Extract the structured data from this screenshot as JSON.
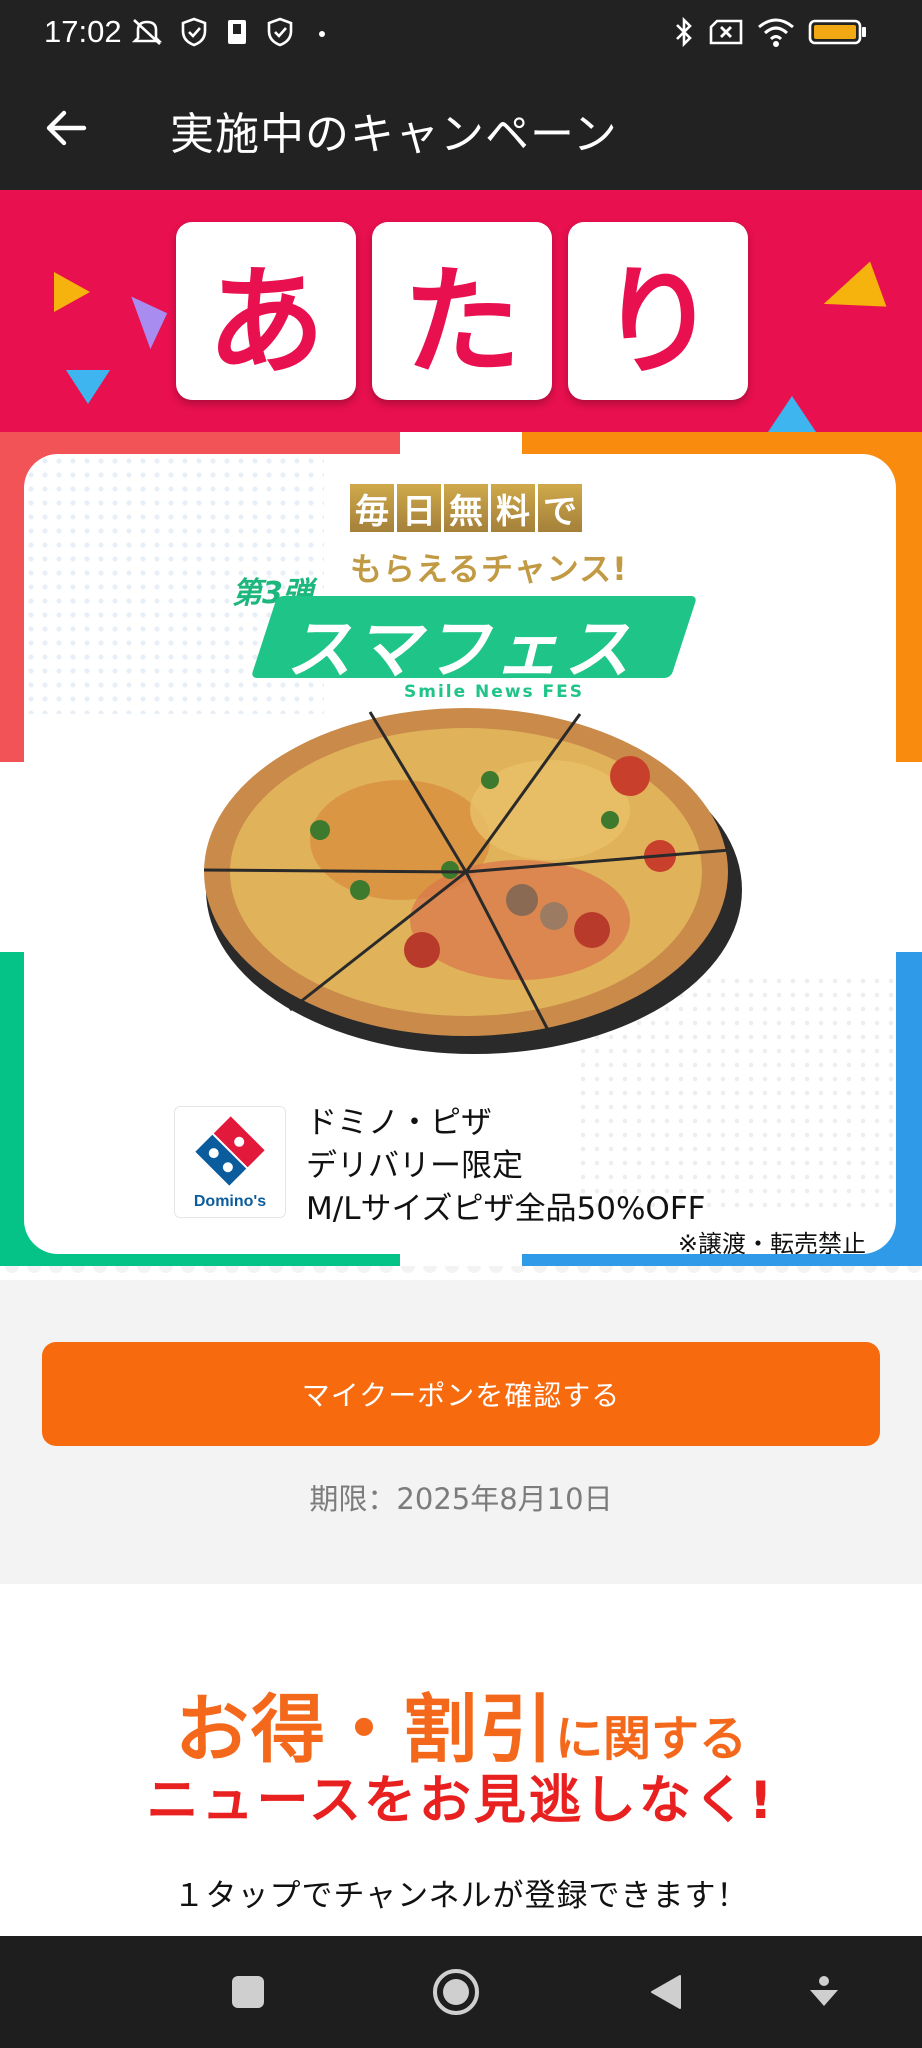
{
  "status_bar": {
    "time": "17:02"
  },
  "header": {
    "title": "実施中のキャンペーン"
  },
  "banner": {
    "tiles": [
      "あ",
      "た",
      "り"
    ]
  },
  "card": {
    "gold_chars": [
      "毎",
      "日",
      "無",
      "料",
      "で"
    ],
    "gold_sub": "もらえるチャンス!",
    "edition": "第3弾",
    "logo_main": "スマフェス",
    "logo_sub": "Smile News FES",
    "brand_logo_text": "Domino's",
    "offer_lines": [
      "ドミノ・ピザ",
      "デリバリー限定",
      "M/Lサイズピザ全品50%OFF"
    ],
    "note": "※譲渡・転売禁止"
  },
  "coupon": {
    "button_label": "マイクーポンを確認する",
    "expiry": "期限：2025年8月10日"
  },
  "promo": {
    "line1_big_a": "お得・割引",
    "line1_small": "に関する",
    "line2": "ニュースをお見逃しなく!",
    "line3": "１タップでチャンネルが登録できます！"
  },
  "colors": {
    "banner": "#e8104e",
    "button": "#f76a0d",
    "logo_green": "#1ec488",
    "promo_orange": "#f4681c",
    "promo_red": "#e8201f"
  }
}
